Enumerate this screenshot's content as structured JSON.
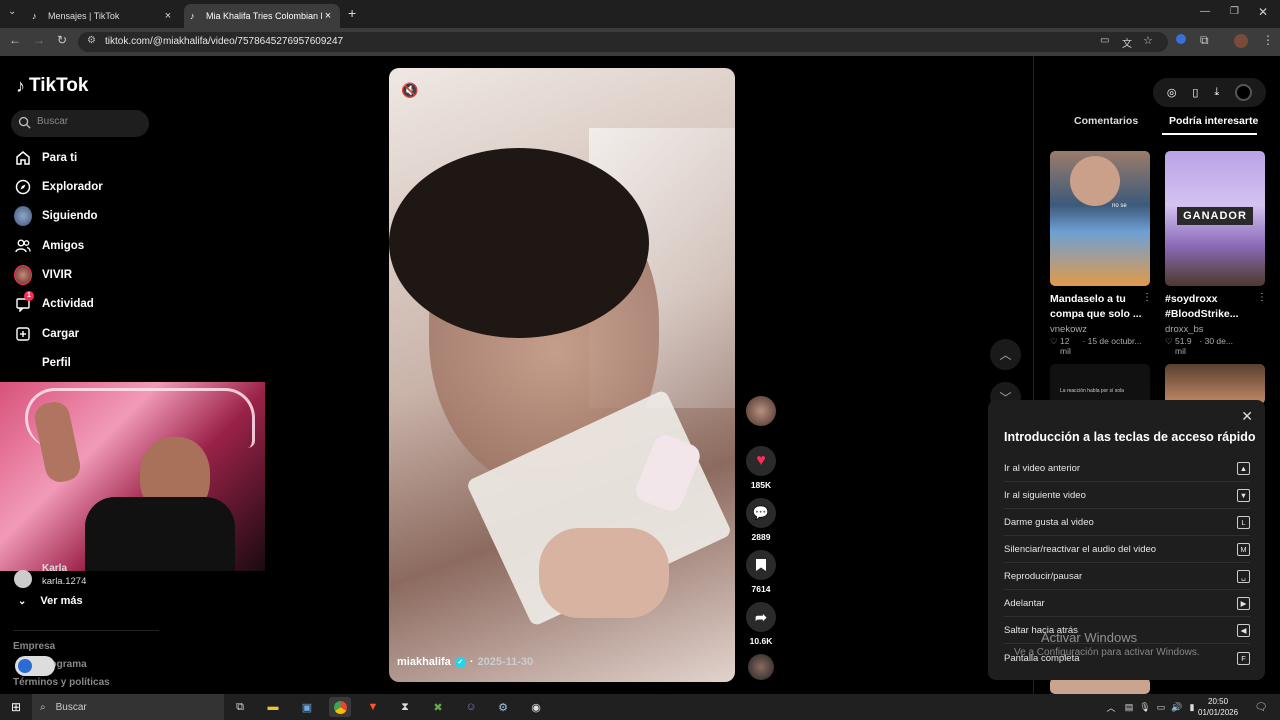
{
  "browser": {
    "tabs": [
      {
        "title": "Mensajes | TikTok",
        "active": false
      },
      {
        "title": "Mia Khalifa Tries Colombian Fo",
        "active": true
      }
    ],
    "url": "tiktok.com/@miakhalifa/video/7578645276957609247",
    "new_tab_glyph": "+",
    "close_glyph": "×"
  },
  "sidebar": {
    "logo": "TikTok",
    "search_placeholder": "Buscar",
    "nav": [
      {
        "label": "Para ti",
        "icon": "home-icon"
      },
      {
        "label": "Explorador",
        "icon": "compass-icon"
      },
      {
        "label": "Siguiendo",
        "icon": "avatar"
      },
      {
        "label": "Amigos",
        "icon": "friends-icon"
      },
      {
        "label": "VIVIR",
        "icon": "avatar"
      },
      {
        "label": "Actividad",
        "icon": "inbox-icon",
        "badge": "1"
      },
      {
        "label": "Cargar",
        "icon": "upload-icon"
      },
      {
        "label": "Perfil",
        "icon": "none"
      }
    ],
    "account_name": "Karla",
    "account_handle": "karla.1274",
    "see_more": "Ver más",
    "footer": [
      "Empresa",
      "Programa",
      "Términos y políticas"
    ]
  },
  "video": {
    "author": "miakhalifa",
    "date": "2025-11-30",
    "verified": true,
    "actions": [
      {
        "name": "like",
        "count": "185K"
      },
      {
        "name": "comment",
        "count": "2889"
      },
      {
        "name": "save",
        "count": "7614"
      },
      {
        "name": "share",
        "count": "10.6K"
      }
    ]
  },
  "right_panel": {
    "tabs": [
      "Comentarios",
      "Podría interesarte"
    ],
    "active_tab": "Podría interesarte",
    "cards": [
      {
        "title": "Mandaselo a tu compa que solo ...",
        "author": "vnekowz",
        "likes": "12 mil",
        "date": "15 de octubr..."
      },
      {
        "title": "#soydroxx #BloodStrike...",
        "author": "droxx_bs",
        "likes": "51.9 mil",
        "date": "30 de..."
      }
    ],
    "thumb2_label": "GANADOR",
    "thumb1_caption": "no se",
    "thumb3_caption": "La reacción habla por sí sola"
  },
  "shortcuts": {
    "title": "Introducción a las teclas de acceso rápido",
    "items": [
      {
        "label": "Ir al video anterior",
        "key": "▲"
      },
      {
        "label": "Ir al siguiente video",
        "key": "▼"
      },
      {
        "label": "Darme gusta al video",
        "key": "L"
      },
      {
        "label": "Silenciar/reactivar el audio del video",
        "key": "M"
      },
      {
        "label": "Reproducir/pausar",
        "key": "␣"
      },
      {
        "label": "Adelantar",
        "key": "▶"
      },
      {
        "label": "Saltar hacia atrás",
        "key": "◀"
      },
      {
        "label": "Pantalla completa",
        "key": "F"
      }
    ]
  },
  "watermark": {
    "line1": "Activar Windows",
    "line2": "Ve a Configuración para activar Windows."
  },
  "taskbar": {
    "search_placeholder": "Buscar",
    "time": "20:50",
    "date": "01/01/2026"
  },
  "colors": {
    "like_red": "#fe2c55",
    "verified_blue": "#20d5ec",
    "badge_red": "#fe2c55"
  }
}
